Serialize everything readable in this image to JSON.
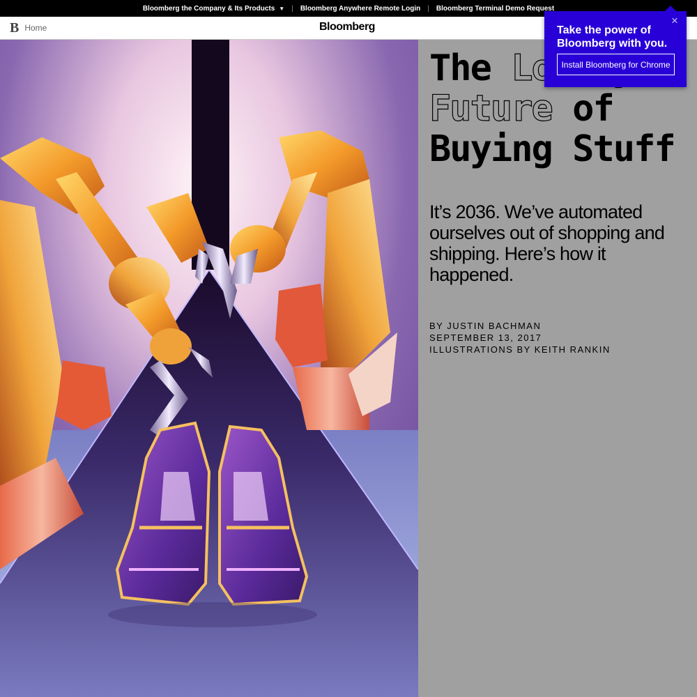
{
  "topbar": {
    "company_label": "Bloomberg the Company & Its Products",
    "remote_login_label": "Bloomberg Anywhere Remote Login",
    "terminal_demo_label": "Bloomberg Terminal Demo Request",
    "separator": "|"
  },
  "navbar": {
    "logo_letter": "B",
    "home_label": "Home",
    "brand": "Bloomberg"
  },
  "article": {
    "headline_word1": "The",
    "headline_word2": "Lonely",
    "headline_word3": "Future",
    "headline_word4": "of",
    "headline_line3": "Buying Stuff",
    "dek": "It’s 2036. We’ve automated ourselves out of shopping and shipping. Here’s how it happened.",
    "byline": "BY JUSTIN BACHMAN",
    "date": "SEPTEMBER 13, 2017",
    "illustrations": "ILLUSTRATIONS BY KEITH RANKIN"
  },
  "popup": {
    "title": "Take the power of Bloomberg with you.",
    "install_label": "Install Bloomberg for Chrome",
    "close_glyph": "×"
  },
  "colors": {
    "popup_bg": "#2800d7",
    "panel_bg": "#a0a0a0",
    "topbar_bg": "#000000"
  }
}
